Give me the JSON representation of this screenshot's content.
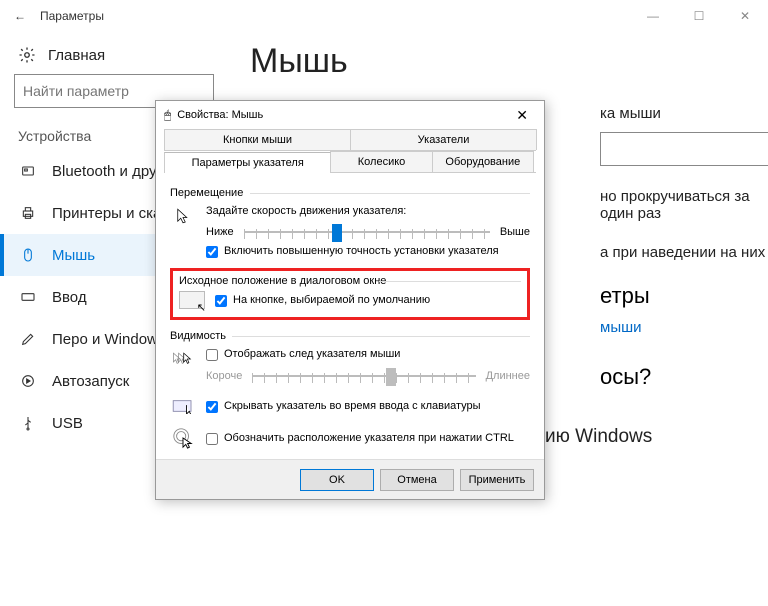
{
  "settings": {
    "window_title": "Параметры",
    "home_label": "Главная",
    "search_placeholder": "Найти параметр",
    "section_label": "Устройства",
    "nav": [
      {
        "label": "Bluetooth и другие"
      },
      {
        "label": "Принтеры и сканеры"
      },
      {
        "label": "Мышь"
      },
      {
        "label": "Ввод"
      },
      {
        "label": "Перо и Windows"
      },
      {
        "label": "Автозапуск"
      },
      {
        "label": "USB"
      }
    ],
    "main_heading": "Мышь",
    "main_button_heading": "ка мыши",
    "scroll_text": "но прокручиваться за один раз",
    "hover_text": "а при наведении на них",
    "related_heading": "етры",
    "related_link": "мыши",
    "questions_heading": "осы?",
    "bottom_text": "Способствуйте совершенствованию Windows"
  },
  "dialog": {
    "title": "Свойства: Мышь",
    "tabs_row1": [
      "Кнопки мыши",
      "Указатели"
    ],
    "tabs_row2": [
      "Параметры указателя",
      "Колесико",
      "Оборудование"
    ],
    "group_move": "Перемещение",
    "speed_label": "Задайте скорость движения указателя:",
    "slow": "Ниже",
    "fast": "Выше",
    "precision_check": "Включить повышенную точность установки указателя",
    "group_snap": "Исходное положение в диалоговом окне",
    "snap_check": "На кнопке, выбираемой по умолчанию",
    "group_visibility": "Видимость",
    "trails_check": "Отображать след указателя мыши",
    "short": "Короче",
    "long": "Длиннее",
    "hide_typing_check": "Скрывать указатель во время ввода с клавиатуры",
    "ctrl_check": "Обозначить расположение указателя при нажатии CTRL",
    "ok": "OK",
    "cancel": "Отмена",
    "apply": "Применить"
  }
}
